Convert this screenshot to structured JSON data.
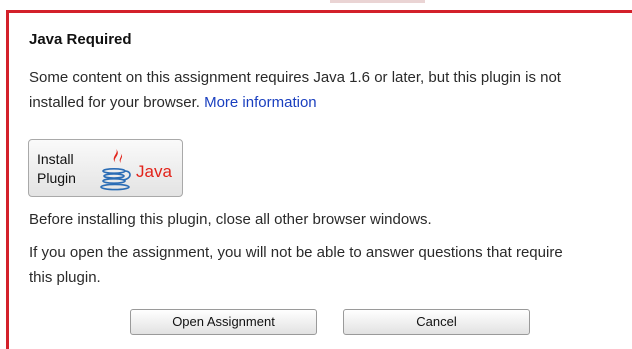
{
  "dialog": {
    "title": "Java Required",
    "message_line1": "Some content on this assignment requires Java 1.6 or later, but this plugin is not",
    "message_line2": "installed for your browser. ",
    "more_info_link": "More information",
    "install_button": {
      "line1": "Install",
      "line2": "Plugin",
      "logo_text": "Java",
      "logo_icon": "java-coffee-cup-icon"
    },
    "before_installing": "Before installing this plugin, close all other browser windows.",
    "warning_line1": "If you open the assignment, you will not be able to answer questions that require",
    "warning_line2": "this plugin.",
    "open_button": "Open Assignment",
    "cancel_button": "Cancel"
  },
  "colors": {
    "accent_border": "#d3202a",
    "link": "#1a3fbf",
    "java_red": "#e2231a",
    "java_blue": "#2a6cb5"
  }
}
